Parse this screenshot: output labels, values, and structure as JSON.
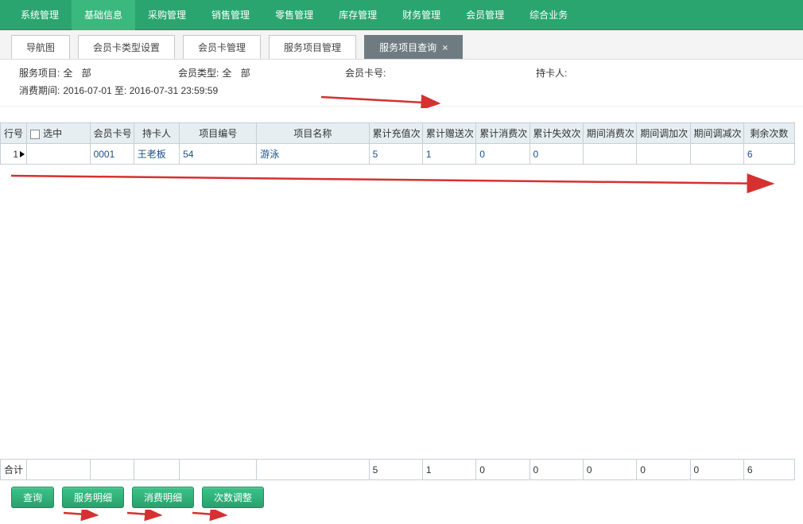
{
  "topMenu": {
    "items": [
      "系统管理",
      "基础信息",
      "采购管理",
      "销售管理",
      "零售管理",
      "库存管理",
      "财务管理",
      "会员管理",
      "综合业务"
    ],
    "activeIndex": 1
  },
  "subTabs": {
    "items": [
      {
        "label": "导航图",
        "closable": false
      },
      {
        "label": "会员卡类型设置",
        "closable": false
      },
      {
        "label": "会员卡管理",
        "closable": false
      },
      {
        "label": "服务项目管理",
        "closable": false
      },
      {
        "label": "服务项目查询",
        "closable": true
      }
    ],
    "activeIndex": 4
  },
  "filters": {
    "serviceItemLabel": "服务项目:",
    "serviceItemValue": "全 部",
    "memberTypeLabel": "会员类型:",
    "memberTypeValue": "全 部",
    "cardNoLabel": "会员卡号:",
    "cardNoValue": "",
    "holderLabel": "持卡人:",
    "holderValue": "",
    "periodLabel": "消费期间:",
    "periodValue": "2016-07-01 至: 2016-07-31 23:59:59"
  },
  "columns": {
    "row": "行号",
    "sel": "选中",
    "card": "会员卡号",
    "holder": "持卡人",
    "code": "项目编号",
    "name": "项目名称",
    "n1": "累计充值次",
    "n2": "累计赠送次",
    "n3": "累计消费次",
    "n4": "累计失效次",
    "n5": "期间消费次",
    "n6": "期间调加次",
    "n7": "期间调减次",
    "rem": "剩余次数"
  },
  "rows": [
    {
      "row": "1",
      "card": "0001",
      "holder": "王老板",
      "code": "54",
      "name": "游泳",
      "n1": "5",
      "n2": "1",
      "n3": "0",
      "n4": "0",
      "n5": "",
      "n6": "",
      "n7": "",
      "rem": "6"
    }
  ],
  "totals": {
    "label": "合计",
    "n1": "5",
    "n2": "1",
    "n3": "0",
    "n4": "0",
    "n5": "0",
    "n6": "0",
    "n7": "0",
    "rem": "6"
  },
  "buttons": {
    "query": "查询",
    "svcDetail": "服务明细",
    "consDetail": "消费明细",
    "adjust": "次数调整"
  },
  "colors": {
    "arrowRed": "#d53131"
  }
}
